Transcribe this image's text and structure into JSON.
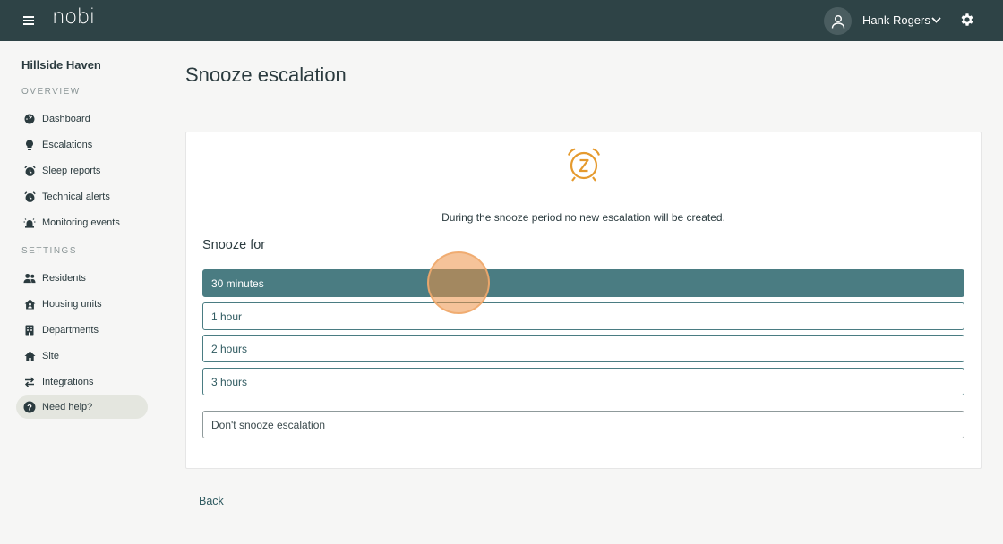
{
  "header": {
    "logo": "nobi",
    "user_name": "Hank Rogers"
  },
  "sidebar": {
    "site_name": "Hillside Haven",
    "overview_label": "OVERVIEW",
    "overview_items": [
      {
        "label": "Dashboard",
        "icon": "dashboard-icon"
      },
      {
        "label": "Escalations",
        "icon": "lightbulb-icon"
      },
      {
        "label": "Sleep reports",
        "icon": "alarm-clock-icon"
      },
      {
        "label": "Technical alerts",
        "icon": "alarm-clock-icon"
      },
      {
        "label": "Monitoring events",
        "icon": "siren-icon"
      }
    ],
    "settings_label": "SETTINGS",
    "settings_items": [
      {
        "label": "Residents",
        "icon": "users-icon"
      },
      {
        "label": "Housing units",
        "icon": "house-user-icon"
      },
      {
        "label": "Departments",
        "icon": "building-icon"
      },
      {
        "label": "Site",
        "icon": "home-icon"
      },
      {
        "label": "Integrations",
        "icon": "arrows-exchange-icon"
      }
    ],
    "help_label": "Need help?"
  },
  "main": {
    "title": "Snooze escalation",
    "notice": "During the snooze period no new escalation will be created.",
    "snooze_for": "Snooze for",
    "options": [
      {
        "label": "30 minutes",
        "selected": true
      },
      {
        "label": "1 hour",
        "selected": false
      },
      {
        "label": "2 hours",
        "selected": false
      },
      {
        "label": "3 hours",
        "selected": false
      }
    ],
    "dont_snooze": "Don't snooze escalation",
    "back": "Back"
  },
  "colors": {
    "topbar": "#2e4346",
    "accent": "#4a7c82",
    "clock_icon": "#e59a2e"
  }
}
